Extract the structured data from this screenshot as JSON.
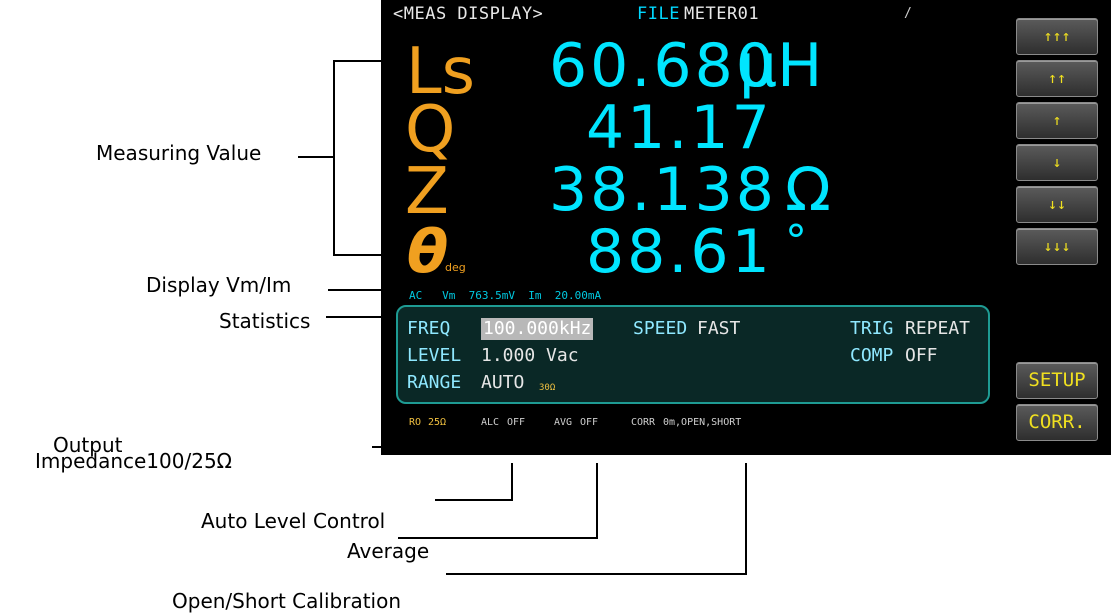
{
  "screen": {
    "title": "<MEAS DISPLAY>",
    "file_label": "FILE",
    "file_name": "METER01",
    "indicator": "/",
    "measurements": [
      {
        "param": "Ls",
        "value": "60.680",
        "unit": "μH"
      },
      {
        "param": "Q",
        "value": "41.17",
        "unit": ""
      },
      {
        "param": "Z",
        "value": "38.138",
        "unit": "Ω"
      },
      {
        "param": "θ",
        "sub": "deg",
        "value": "88.61",
        "unit": "°"
      }
    ],
    "vm_im": {
      "mode": "AC",
      "vm_label": "Vm",
      "vm": "763.5mV",
      "im_label": "Im",
      "im": "20.00mA"
    },
    "stats": {
      "freq_label": "FREQ",
      "freq": "100.000kHz",
      "speed_label": "SPEED",
      "speed": "FAST",
      "trig_label": "TRIG",
      "trig": "REPEAT",
      "level_label": "LEVEL",
      "level": "1.000 Vac",
      "comp_label": "COMP",
      "comp": "OFF",
      "range_label": "RANGE",
      "range": "AUTO",
      "range_sub": "30Ω"
    },
    "footer": {
      "ro_label": "RO",
      "ro": "25Ω",
      "alc_label": "ALC",
      "alc": "OFF",
      "avg_label": "AVG",
      "avg": "OFF",
      "corr_label": "CORR",
      "corr": "0m,OPEN,SHORT"
    },
    "side_buttons": [
      "↑↑↑",
      "↑↑",
      "↑",
      "↓",
      "↓↓",
      "↓↓↓"
    ],
    "setup_button": "SETUP",
    "corr_button": "CORR."
  },
  "annotations": {
    "measuring_value": "Measuring Value",
    "display_vm_im": "Display Vm/Im",
    "statistics": "Statistics",
    "output_line1": "Output",
    "output_line2": "Impedance100/25Ω",
    "alc": "Auto Level Control",
    "average": "Average",
    "open_short": "Open/Short Calibration"
  }
}
